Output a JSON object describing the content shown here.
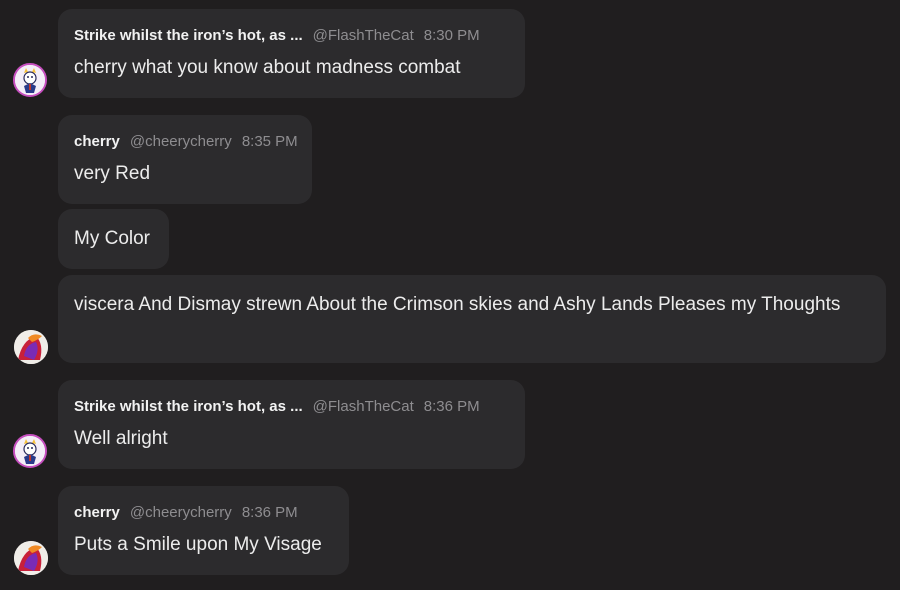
{
  "users": {
    "flash": {
      "name": "Strike whilst the iron’s hot, as ...",
      "handle": "@FlashTheCat"
    },
    "cherry": {
      "name": "cherry",
      "handle": "@cheerycherry"
    }
  },
  "messages": [
    {
      "author": "flash",
      "time": "8:30 PM",
      "text": "cherry what you know about madness combat"
    },
    {
      "author": "cherry",
      "time": "8:35 PM",
      "text": "very Red"
    },
    {
      "author": "cherry",
      "text": "My Color"
    },
    {
      "author": "cherry",
      "text": "viscera And Dismay strewn About the Crimson skies and Ashy Lands Pleases my Thoughts"
    },
    {
      "author": "flash",
      "time": "8:36 PM",
      "text": "Well alright"
    },
    {
      "author": "cherry",
      "time": "8:36 PM",
      "text": "Puts a Smile upon My Visage"
    }
  ],
  "colors": {
    "background": "#201e1f",
    "bubble": "#2c2b2d",
    "avatar_ring": "#c64fbf"
  }
}
